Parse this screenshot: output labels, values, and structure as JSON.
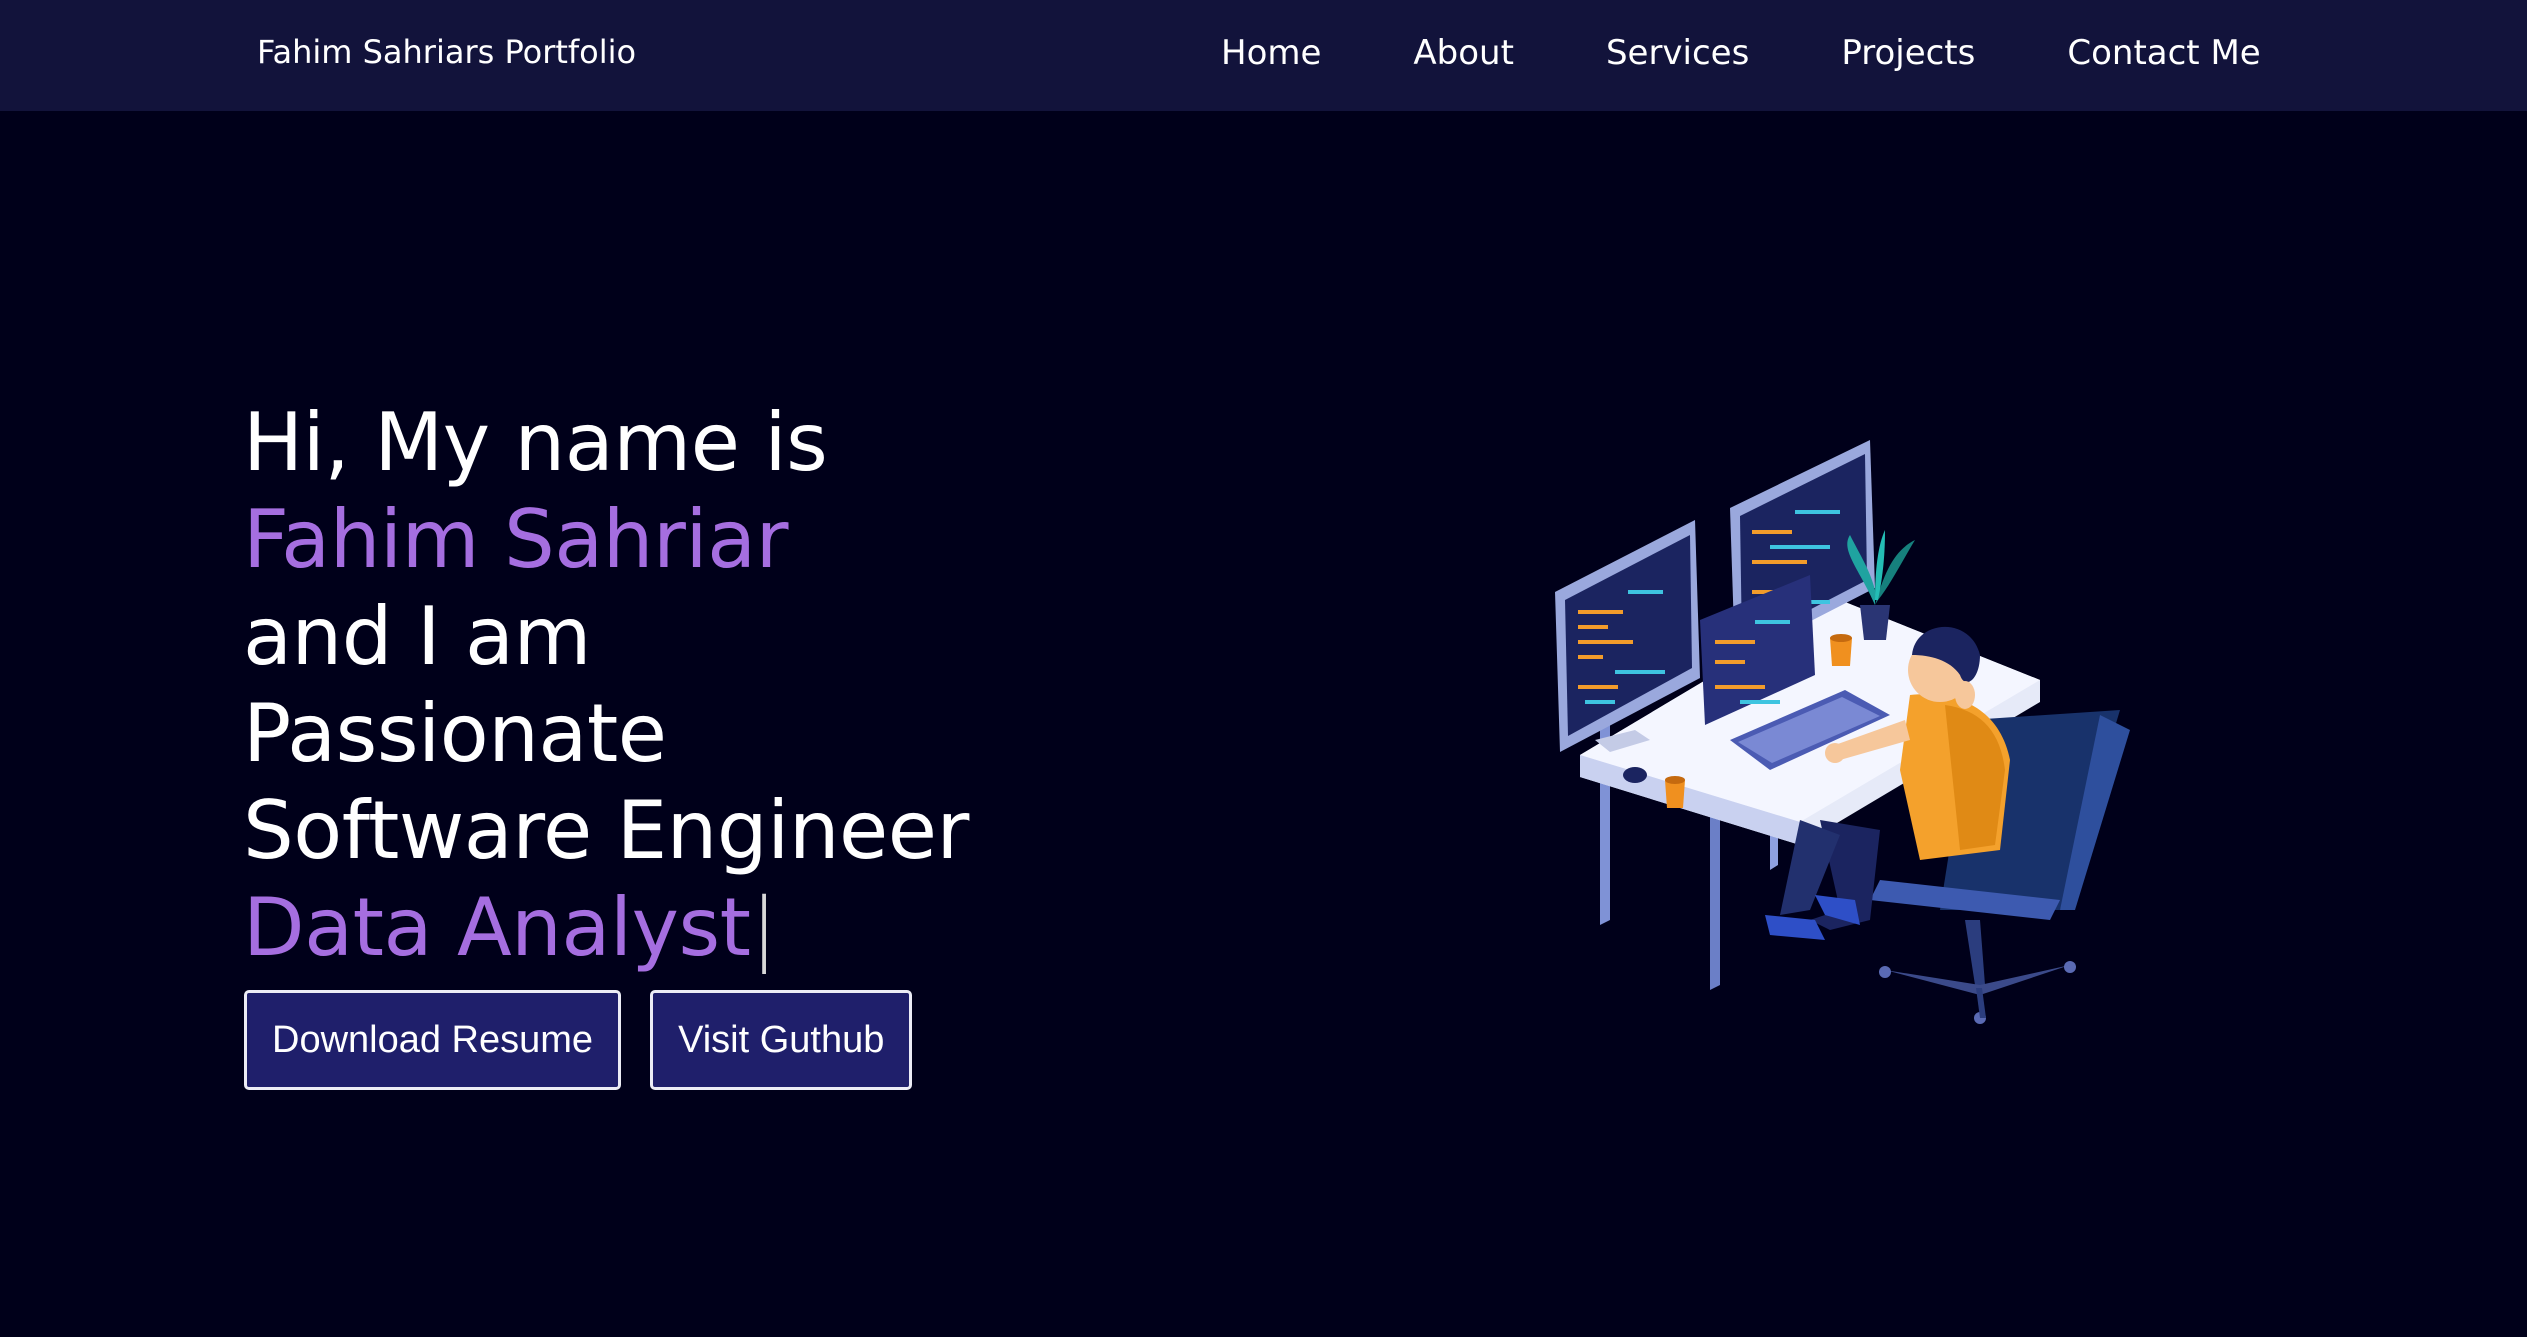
{
  "navbar": {
    "brand": "Fahim Sahriars Portfolio",
    "links": [
      {
        "label": "Home"
      },
      {
        "label": "About"
      },
      {
        "label": "Services"
      },
      {
        "label": "Projects"
      },
      {
        "label": "Contact Me"
      }
    ]
  },
  "hero": {
    "greeting": "Hi, My name is",
    "name": "Fahim Sahriar",
    "intro": "and I am",
    "line_passionate": "Passionate",
    "line_role": "Software Engineer",
    "typed_role": "Data Analyst",
    "cursor": "|",
    "buttons": {
      "resume": "Download Resume",
      "github": "Visit Guthub"
    }
  },
  "illustration": {
    "icon": "developer-at-desk-illustration"
  },
  "colors": {
    "background": "#00001a",
    "navbar": "#12133b",
    "accent": "#a56ee0",
    "button_bg": "#1f1f6b",
    "button_border": "#ececf6"
  }
}
